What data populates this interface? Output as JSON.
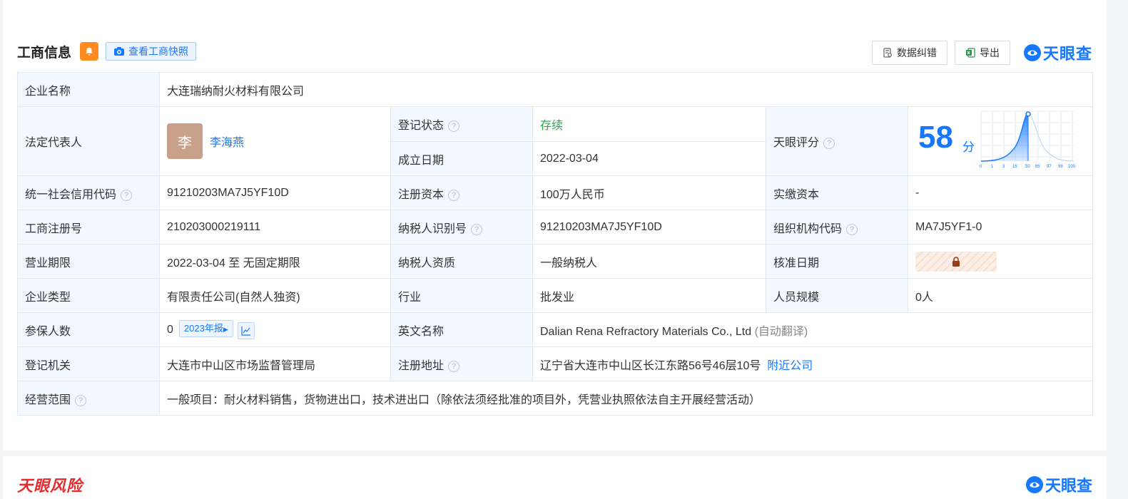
{
  "header": {
    "title": "工商信息",
    "snapshot_label": "查看工商快照",
    "correct_label": "数据纠错",
    "export_label": "导出",
    "brand": "天眼查"
  },
  "info": {
    "company_name_label": "企业名称",
    "company_name": "大连瑞纳耐火材料有限公司",
    "legal_rep_label": "法定代表人",
    "legal_rep_avatar": "李",
    "legal_rep_name": "李海燕",
    "reg_status_label": "登记状态",
    "reg_status": "存续",
    "found_date_label": "成立日期",
    "found_date": "2022-03-04",
    "tianyan_score_label": "天眼评分",
    "score": "58",
    "score_unit": "分",
    "score_axis": [
      "0",
      "1",
      "3",
      "15",
      "50",
      "85",
      "97",
      "99",
      "100"
    ],
    "credit_code_label": "统一社会信用代码",
    "credit_code": "91210203MA7J5YF10D",
    "reg_capital_label": "注册资本",
    "reg_capital": "100万人民币",
    "paid_capital_label": "实缴资本",
    "paid_capital": "-",
    "biz_reg_no_label": "工商注册号",
    "biz_reg_no": "210203000219111",
    "taxpayer_id_label": "纳税人识别号",
    "taxpayer_id": "91210203MA7J5YF10D",
    "org_code_label": "组织机构代码",
    "org_code": "MA7J5YF1-0",
    "term_label": "营业期限",
    "term": "2022-03-04 至 无固定期限",
    "taxpayer_type_label": "纳税人资质",
    "taxpayer_type": "一般纳税人",
    "approve_date_label": "核准日期",
    "company_type_label": "企业类型",
    "company_type": "有限责任公司(自然人独资)",
    "industry_label": "行业",
    "industry": "批发业",
    "staff_size_label": "人员规模",
    "staff_size": "0人",
    "insured_label": "参保人数",
    "insured": "0",
    "insured_year": "2023年报",
    "english_name_label": "英文名称",
    "english_name": "Dalian Rena Refractory Materials Co., Ltd",
    "english_name_note": "(自动翻译)",
    "authority_label": "登记机关",
    "authority": "大连市中山区市场监督管理局",
    "address_label": "注册地址",
    "address": "辽宁省大连市中山区长江东路56号46层10号",
    "nearby_label": "附近公司",
    "scope_label": "经营范围",
    "scope": "一般项目：耐火材料销售，货物进出口，技术进出口（除依法须经批准的项目外，凭营业执照依法自主开展经营活动）"
  },
  "footer": {
    "risk_title": "天眼风险",
    "brand": "天眼查"
  },
  "colors": {
    "accent": "#1677ff",
    "label_bg": "#f2f8ff",
    "status_green": "#2aa84a",
    "risk_red": "#e62b2b",
    "bell_orange": "#ff8a1f"
  }
}
